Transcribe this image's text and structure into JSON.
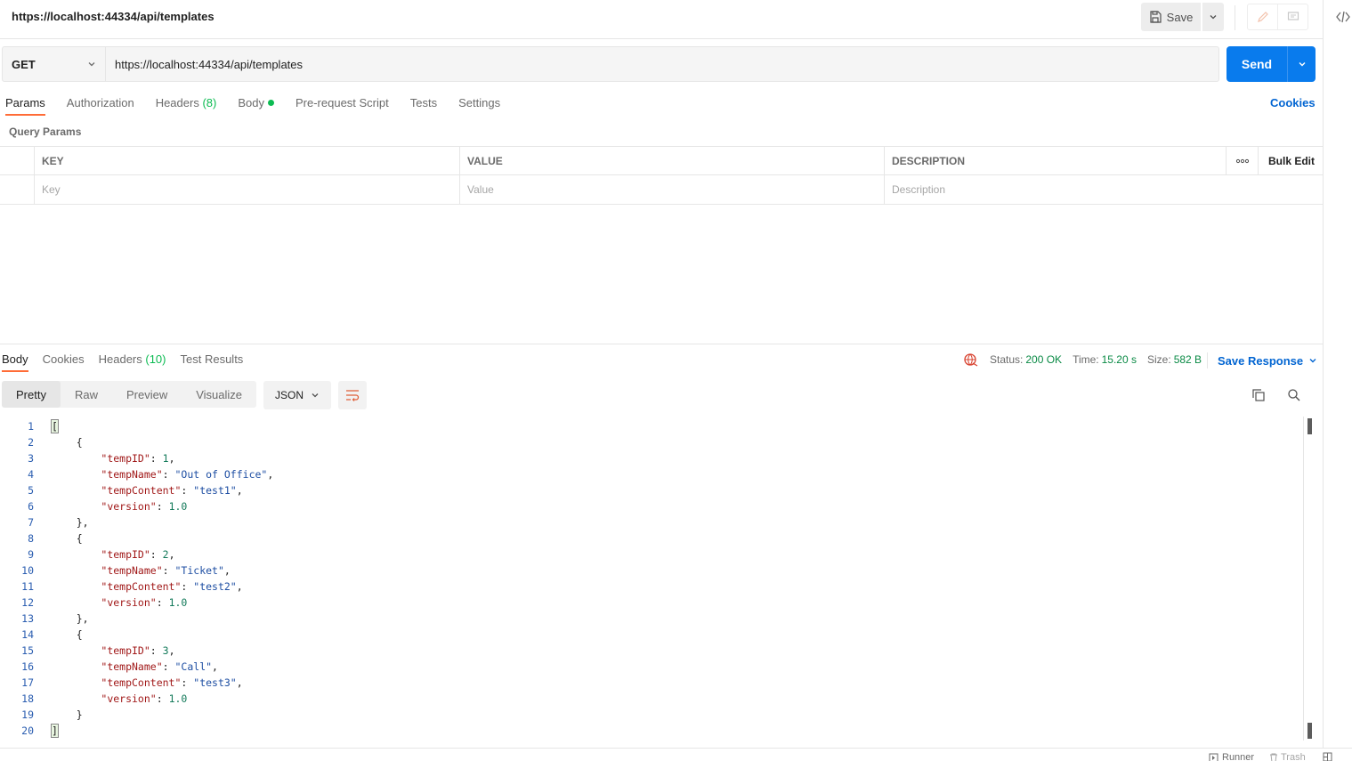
{
  "header": {
    "request_title": "https://localhost:44334/api/templates",
    "save_label": "Save"
  },
  "request": {
    "method": "GET",
    "url": "https://localhost:44334/api/templates",
    "send_label": "Send"
  },
  "request_tabs": [
    {
      "label": "Params",
      "active": true
    },
    {
      "label": "Authorization"
    },
    {
      "label": "Headers",
      "count": "(8)"
    },
    {
      "label": "Body"
    },
    {
      "label": "Pre-request Script"
    },
    {
      "label": "Tests"
    },
    {
      "label": "Settings"
    }
  ],
  "cookies_label": "Cookies",
  "query_params": {
    "title": "Query Params",
    "columns": [
      "KEY",
      "VALUE",
      "DESCRIPTION"
    ],
    "bulk_edit": "Bulk Edit",
    "placeholders": {
      "key": "Key",
      "value": "Value",
      "description": "Description"
    }
  },
  "response_tabs": [
    {
      "label": "Body",
      "active": true
    },
    {
      "label": "Cookies"
    },
    {
      "label": "Headers",
      "count": "(10)"
    },
    {
      "label": "Test Results"
    }
  ],
  "status": {
    "status_label": "Status:",
    "status_value": "200 OK",
    "time_label": "Time:",
    "time_value": "15.20 s",
    "size_label": "Size:",
    "size_value": "582 B",
    "save_response": "Save Response"
  },
  "view_modes": [
    "Pretty",
    "Raw",
    "Preview",
    "Visualize"
  ],
  "format": "JSON",
  "code_lines": [
    [
      {
        "t": "p",
        "v": "["
      }
    ],
    [
      {
        "t": "p",
        "v": "    {"
      }
    ],
    [
      {
        "t": "p",
        "v": "        "
      },
      {
        "t": "k",
        "v": "\"tempID\""
      },
      {
        "t": "p",
        "v": ": "
      },
      {
        "t": "n",
        "v": "1"
      },
      {
        "t": "p",
        "v": ","
      }
    ],
    [
      {
        "t": "p",
        "v": "        "
      },
      {
        "t": "k",
        "v": "\"tempName\""
      },
      {
        "t": "p",
        "v": ": "
      },
      {
        "t": "s",
        "v": "\"Out of Office\""
      },
      {
        "t": "p",
        "v": ","
      }
    ],
    [
      {
        "t": "p",
        "v": "        "
      },
      {
        "t": "k",
        "v": "\"tempContent\""
      },
      {
        "t": "p",
        "v": ": "
      },
      {
        "t": "s",
        "v": "\"test1\""
      },
      {
        "t": "p",
        "v": ","
      }
    ],
    [
      {
        "t": "p",
        "v": "        "
      },
      {
        "t": "k",
        "v": "\"version\""
      },
      {
        "t": "p",
        "v": ": "
      },
      {
        "t": "n",
        "v": "1.0"
      }
    ],
    [
      {
        "t": "p",
        "v": "    },"
      }
    ],
    [
      {
        "t": "p",
        "v": "    {"
      }
    ],
    [
      {
        "t": "p",
        "v": "        "
      },
      {
        "t": "k",
        "v": "\"tempID\""
      },
      {
        "t": "p",
        "v": ": "
      },
      {
        "t": "n",
        "v": "2"
      },
      {
        "t": "p",
        "v": ","
      }
    ],
    [
      {
        "t": "p",
        "v": "        "
      },
      {
        "t": "k",
        "v": "\"tempName\""
      },
      {
        "t": "p",
        "v": ": "
      },
      {
        "t": "s",
        "v": "\"Ticket\""
      },
      {
        "t": "p",
        "v": ","
      }
    ],
    [
      {
        "t": "p",
        "v": "        "
      },
      {
        "t": "k",
        "v": "\"tempContent\""
      },
      {
        "t": "p",
        "v": ": "
      },
      {
        "t": "s",
        "v": "\"test2\""
      },
      {
        "t": "p",
        "v": ","
      }
    ],
    [
      {
        "t": "p",
        "v": "        "
      },
      {
        "t": "k",
        "v": "\"version\""
      },
      {
        "t": "p",
        "v": ": "
      },
      {
        "t": "n",
        "v": "1.0"
      }
    ],
    [
      {
        "t": "p",
        "v": "    },"
      }
    ],
    [
      {
        "t": "p",
        "v": "    {"
      }
    ],
    [
      {
        "t": "p",
        "v": "        "
      },
      {
        "t": "k",
        "v": "\"tempID\""
      },
      {
        "t": "p",
        "v": ": "
      },
      {
        "t": "n",
        "v": "3"
      },
      {
        "t": "p",
        "v": ","
      }
    ],
    [
      {
        "t": "p",
        "v": "        "
      },
      {
        "t": "k",
        "v": "\"tempName\""
      },
      {
        "t": "p",
        "v": ": "
      },
      {
        "t": "s",
        "v": "\"Call\""
      },
      {
        "t": "p",
        "v": ","
      }
    ],
    [
      {
        "t": "p",
        "v": "        "
      },
      {
        "t": "k",
        "v": "\"tempContent\""
      },
      {
        "t": "p",
        "v": ": "
      },
      {
        "t": "s",
        "v": "\"test3\""
      },
      {
        "t": "p",
        "v": ","
      }
    ],
    [
      {
        "t": "p",
        "v": "        "
      },
      {
        "t": "k",
        "v": "\"version\""
      },
      {
        "t": "p",
        "v": ": "
      },
      {
        "t": "n",
        "v": "1.0"
      }
    ],
    [
      {
        "t": "p",
        "v": "    }"
      }
    ],
    [
      {
        "t": "p",
        "v": "]"
      }
    ]
  ],
  "footer": {
    "runner": "Runner",
    "trash": "Trash"
  },
  "colors": {
    "accent": "#ff6c37",
    "primary": "#097bed",
    "success": "#0cbb52",
    "link": "#0265d2"
  }
}
